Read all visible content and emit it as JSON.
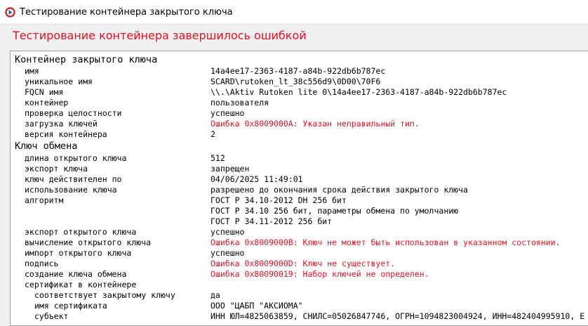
{
  "window": {
    "title": "Тестирование контейнера закрытого ключа",
    "icon": "app-icon",
    "status": "Тестирование контейнера завершилось ошибкой",
    "error_color": "#e81123"
  },
  "report": {
    "container_section": "Контейнер закрытого ключа",
    "container": [
      {
        "label": "имя",
        "value": "14a4ee17-2363-4187-a84b-922db6b787ec"
      },
      {
        "label": "уникальное имя",
        "value": "SCARD\\rutoken_lt_38c556d9\\0D00\\70F6"
      },
      {
        "label": "FQCN имя",
        "value": "\\\\.\\Aktiv Rutoken lite 0\\14a4ee17-2363-4187-a84b-922db6b787ec"
      },
      {
        "label": "контейнер",
        "value": "пользователя"
      },
      {
        "label": "проверка целостности",
        "value": "успешно"
      },
      {
        "label": "загрузка ключей",
        "value": "Ошибка 0x8009000A: Указан неправильный тип."
      },
      {
        "label": "версия контейнера",
        "value": "2"
      }
    ],
    "exchange_section": "Ключ обмена",
    "exchange": [
      {
        "label": "длина открытого ключа",
        "value": "512"
      },
      {
        "label": "экспорт ключа",
        "value": "запрещен"
      },
      {
        "label": "ключ действителен по",
        "value": "04/06/2025 11:49:01"
      },
      {
        "label": "использование ключа",
        "value": "разрешено до окончания срока действия закрытого ключа"
      },
      {
        "label": "алгоритм",
        "value": "ГОСТ Р 34.10-2012 DH 256 бит"
      },
      {
        "label": "",
        "value": "ГОСТ Р 34.10 256 бит, параметры обмена по умолчанию"
      },
      {
        "label": "",
        "value": "ГОСТ Р 34.11-2012 256 бит"
      },
      {
        "label": "экспорт открытого ключа",
        "value": "успешно"
      },
      {
        "label": "вычисление открытого ключа",
        "value": "Ошибка 0x8009000B: Ключ не может быть использован в указанном состоянии."
      },
      {
        "label": "импорт открытого ключа",
        "value": "успешно"
      },
      {
        "label": "подпись",
        "value": "Ошибка 0x8009000D: Ключ не существует."
      },
      {
        "label": "создание ключа обмена",
        "value": "Ошибка 0x80090019: Набор ключей не определен."
      },
      {
        "label": "сертификат в контейнере",
        "value": ""
      },
      {
        "label": "соответствует закрытому ключу",
        "value": "да"
      },
      {
        "label": "имя сертификата",
        "value": "ООО \"ЦАБП \"АКСИОМА\""
      },
      {
        "label": "субъект",
        "value": "ИНН ЮЛ=4825063859, СНИЛС=05026847746, ОГРН=1094823004924, ИНН=482404995910, E"
      }
    ]
  }
}
